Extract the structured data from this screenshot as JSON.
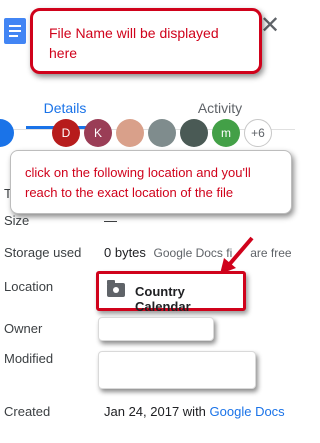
{
  "header": {
    "callout_line1": "File Name will be displayed",
    "callout_line2": "here",
    "close_glyph": "✕"
  },
  "tabs": [
    {
      "label": "Details",
      "active": true
    },
    {
      "label": "Activity",
      "active": false
    }
  ],
  "people": [
    "D",
    "K",
    "",
    "",
    "m",
    "+6"
  ],
  "instruction": {
    "line1": "click on the following location and you'll",
    "line2": "reach to the exact location of the file"
  },
  "details": {
    "size": {
      "label": "Size",
      "value": "—"
    },
    "storage": {
      "label": "Storage used",
      "value": "0 bytes",
      "note_a": "Google Docs fi",
      "note_b": "are free"
    },
    "location": {
      "label": "Location",
      "value": "Country Calendar"
    },
    "owner": {
      "label": "Owner"
    },
    "modified": {
      "label": "Modified"
    },
    "created": {
      "label": "Created",
      "date": "Jan 24, 2017 with ",
      "app": "Google Docs"
    },
    "type_label_fragment": "T"
  },
  "colors": {
    "accent": "#1a73e8",
    "annotation": "#d0021b",
    "doc_icon": "#4285f4"
  }
}
